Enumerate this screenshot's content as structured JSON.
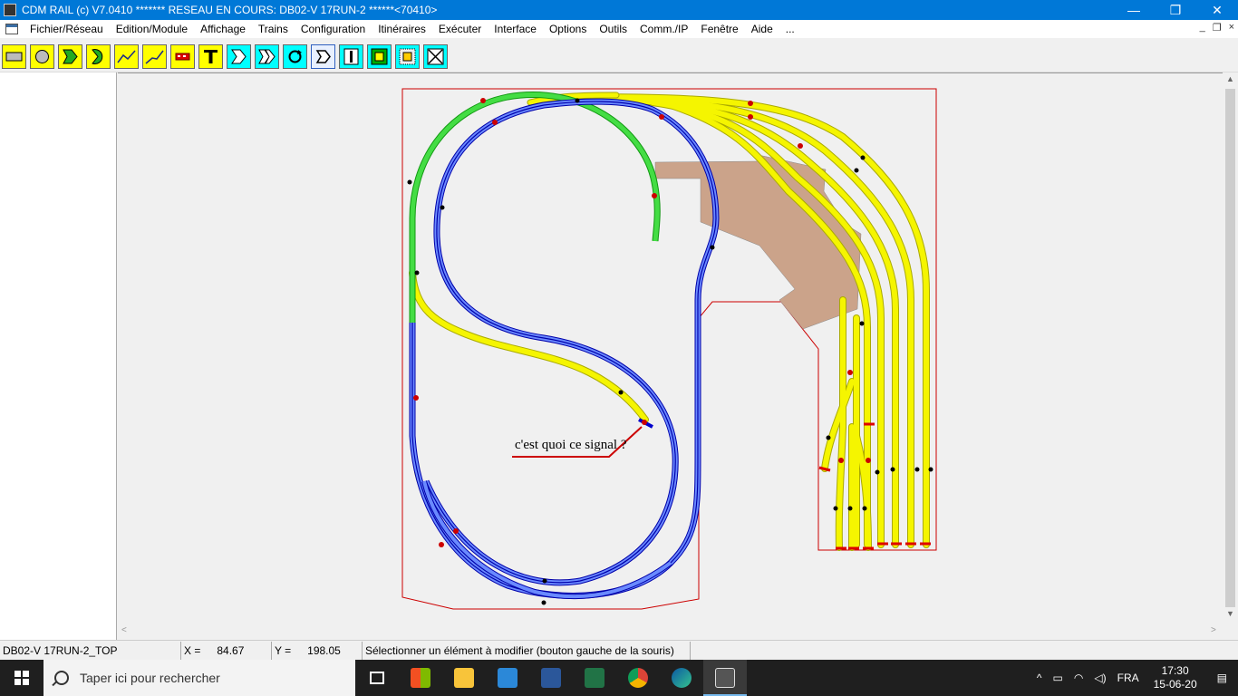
{
  "window": {
    "title": "CDM RAIL (c) V7.0410      ******* RESEAU EN COURS: DB02-V 17RUN-2 ******<70410>",
    "controls": [
      "—",
      "❐",
      "✕"
    ]
  },
  "menu": {
    "items": [
      "Fichier/Réseau",
      "Edition/Module",
      "Affichage",
      "Trains",
      "Configuration",
      "Itinéraires",
      "Exécuter",
      "Interface",
      "Options",
      "Outils",
      "Comm./IP",
      "Fenêtre",
      "Aide",
      "..."
    ],
    "mdi_controls": [
      "_",
      "❐",
      "×"
    ]
  },
  "toolbar": {
    "tools": [
      "rectangle-tool",
      "ellipse-tool",
      "pentagon-tool",
      "pacman-tool",
      "track-curve-tool",
      "track-line-tool",
      "train-tool",
      "text-tool",
      "arrow-right-tool",
      "double-arrow-tool",
      "rotate-tool",
      "select-tool",
      "signal-tool",
      "color-tool",
      "grid-tool",
      "cross-tool"
    ]
  },
  "canvas": {
    "annotation": "c'est quoi ce signal ?",
    "colors": {
      "blue_track": "#0000cc",
      "yellow_track": "#f5f500",
      "green_track": "#22cc22",
      "terrain": "#cba38a",
      "border": "#cc0000"
    }
  },
  "status": {
    "module": "DB02-V 17RUN-2_TOP",
    "x_label": "X =",
    "x_value": "84.67",
    "y_label": "Y =",
    "y_value": "198.05",
    "message": "Sélectionner un élément à modifier (bouton gauche de la souris)"
  },
  "taskbar": {
    "search_placeholder": "Taper ici pour rechercher",
    "language": "FRA",
    "time": "17:30",
    "date": "15-06-20"
  }
}
